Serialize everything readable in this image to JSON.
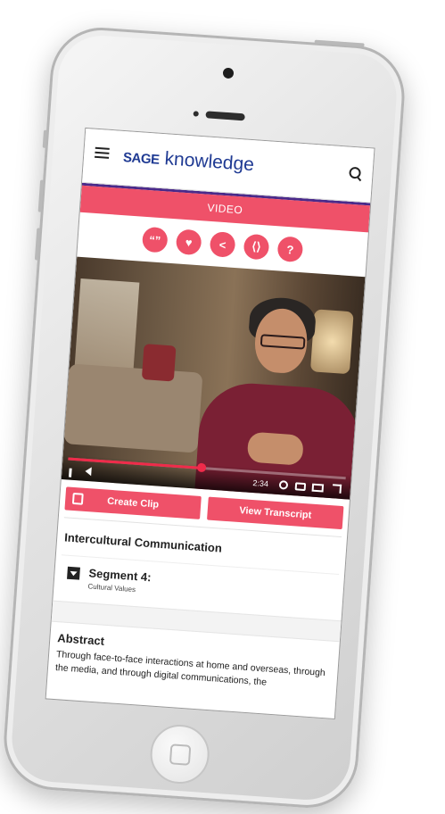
{
  "header": {
    "logo_mark": "SAGE",
    "logo_text": "knowledge"
  },
  "tab": {
    "label": "VIDEO"
  },
  "actions": [
    {
      "name": "cite",
      "glyph": "“”"
    },
    {
      "name": "favorite",
      "glyph": "♥"
    },
    {
      "name": "share",
      "glyph": "<"
    },
    {
      "name": "embed",
      "glyph": "⟨⟩"
    },
    {
      "name": "help",
      "glyph": "?"
    }
  ],
  "player": {
    "time_current": "2:34",
    "progress": 0.48
  },
  "buttons": {
    "create_clip": "Create Clip",
    "view_transcript": "View Transcript"
  },
  "content": {
    "title": "Intercultural Communication",
    "segment_title": "Segment 4:",
    "segment_subtitle": "Cultural Values"
  },
  "abstract": {
    "heading": "Abstract",
    "body": "Through face-to-face interactions at home and overseas, through the media, and through digital communications, the"
  },
  "colors": {
    "accent": "#ef5169",
    "brand": "#1f3a93",
    "nav_line": "#4a2a8a"
  }
}
